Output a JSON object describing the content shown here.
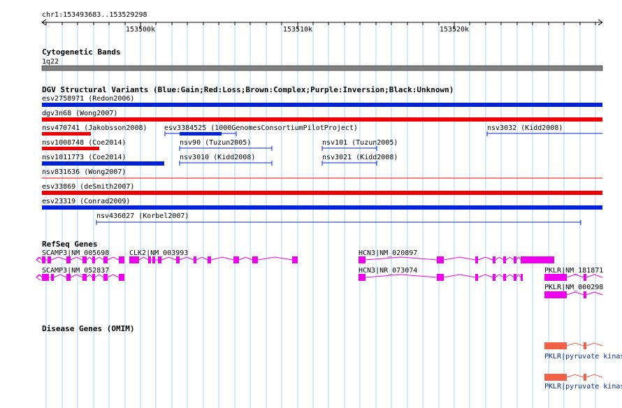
{
  "colors": {
    "grid": "#a8d4ea",
    "gain": "#0022dd",
    "loss": "#ee0000",
    "gene": "#ee00ee",
    "omim": "#f26045",
    "band": "#808080",
    "omim_label": "#0b2a8c"
  },
  "ruler": {
    "location": "chr1:153493683..153529298",
    "ticks": [
      "153500k",
      "153510k",
      "153520k"
    ]
  },
  "cytoband": {
    "title": "Cytogenetic Bands",
    "band": "1q22"
  },
  "dgv": {
    "title": "DGV Structural Variants (Blue:Gain;Red:Loss;Brown:Complex;Purple:Inversion;Black:Unknown)",
    "items": [
      {
        "label": "esv2758971 (Redon2006)",
        "type": "gain"
      },
      {
        "label": "dgv3n68 (Wong2007)",
        "type": "loss"
      },
      {
        "label": "nsv470741 (Jakobsson2008)",
        "type": "loss"
      },
      {
        "label": "esv3384525 (1000GenomesConsortiumPilotProject)",
        "type": "gain"
      },
      {
        "label": "nsv3032 (Kidd2008)",
        "type": "gain"
      },
      {
        "label": "nsv1008748 (Coe2014)",
        "type": "loss"
      },
      {
        "label": "nsv90 (Tuzun2005)",
        "type": "gain"
      },
      {
        "label": "nsv101 (Tuzun2005)",
        "type": "gain"
      },
      {
        "label": "nsv1011773 (Coe2014)",
        "type": "gain"
      },
      {
        "label": "nsv3010 (Kidd2008)",
        "type": "gain"
      },
      {
        "label": "nsv3021 (Kidd2008)",
        "type": "gain"
      },
      {
        "label": "nsv831636 (Wong2007)",
        "type": "loss"
      },
      {
        "label": "esv33869 (deSmith2007)",
        "type": "loss"
      },
      {
        "label": "esv23319 (Conrad2009)",
        "type": "gain"
      },
      {
        "label": "nsv436027 (Korbel2007)",
        "type": "gain"
      }
    ]
  },
  "refseq": {
    "title": "RefSeq Genes",
    "genes": [
      "SCAMP3|NM_005698",
      "CLK2|NM_003993",
      "HCN3|NM_020897",
      "SCAMP3|NM_052837",
      "HCN3|NR_073074",
      "PKLR|NM_181871",
      "PKLR|NM_000298"
    ]
  },
  "omim": {
    "title": "Disease Genes (OMIM)",
    "items": [
      "PKLR|pyruvate kinase",
      "PKLR|pyruvate kinase"
    ]
  }
}
